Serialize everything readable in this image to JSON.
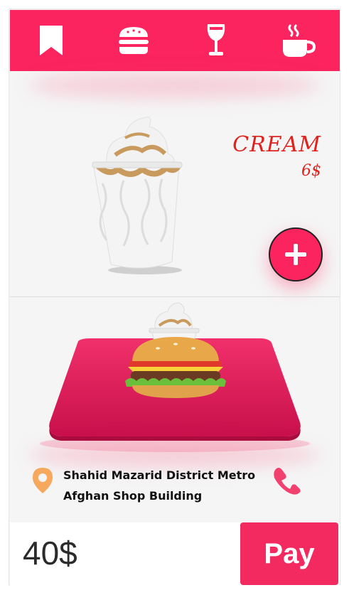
{
  "colors": {
    "accent": "#fb245f",
    "product_text": "#e0221d",
    "pin": "#f6a85c"
  },
  "nav": {
    "items": [
      {
        "icon": "bookmark-icon"
      },
      {
        "icon": "burger-icon"
      },
      {
        "icon": "wine-glass-icon"
      },
      {
        "icon": "coffee-cup-icon"
      }
    ]
  },
  "product": {
    "name": "CREAM",
    "price": "6$",
    "image": "ice-cream-cup",
    "add_button_icon": "plus-icon"
  },
  "order_preview": {
    "tray_items": [
      "ice-cream-cup",
      "hamburger"
    ]
  },
  "address": {
    "line1": "Shahid Mazarid District Metro",
    "line2": "Afghan Shop Building"
  },
  "checkout": {
    "total": "40$",
    "pay_label": "Pay"
  }
}
